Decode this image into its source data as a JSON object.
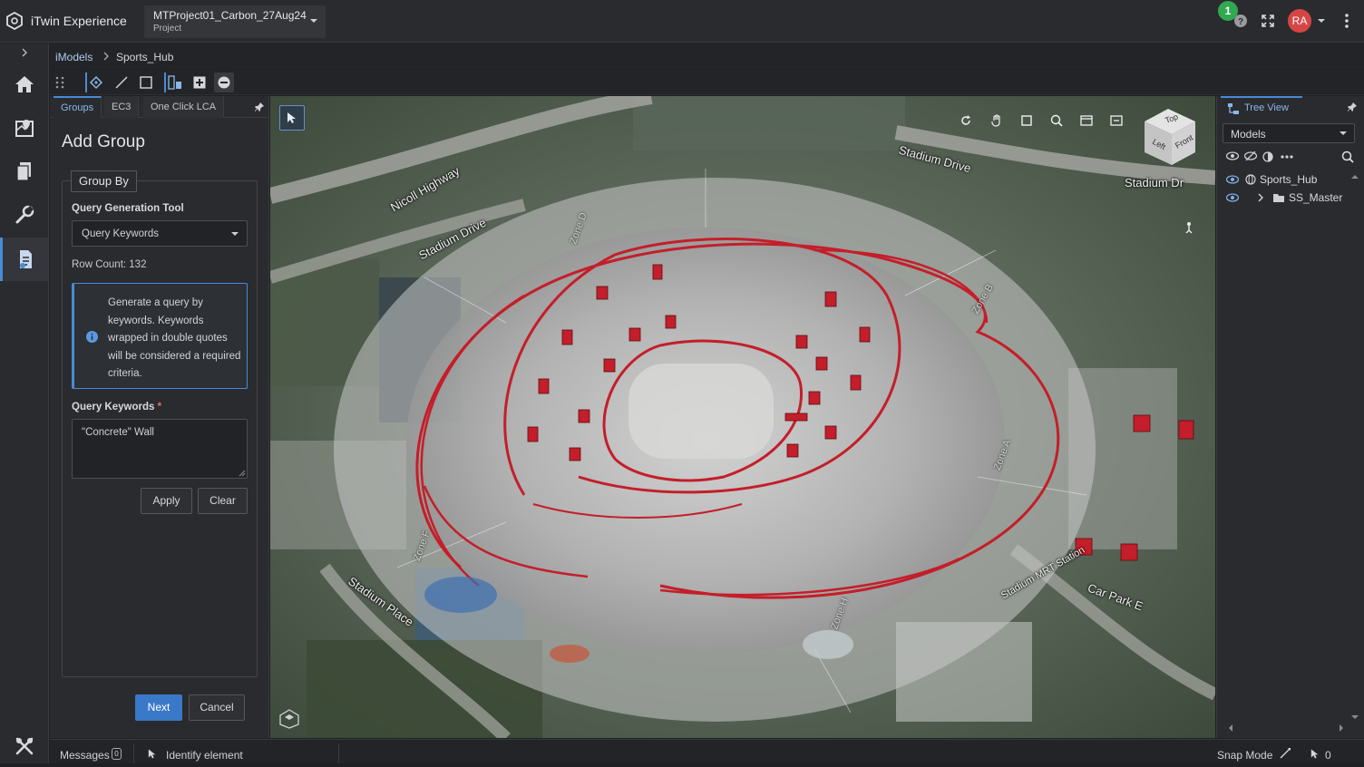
{
  "header": {
    "app_title": "iTwin Experience",
    "project_name": "MTProject01_Carbon_27Aug24",
    "project_type": "Project",
    "notification_count": "1",
    "user_initials": "RA"
  },
  "left_nav": {
    "items": [
      {
        "icon": "expand-chevron-icon"
      },
      {
        "icon": "home-icon"
      },
      {
        "icon": "map-pin-icon"
      },
      {
        "icon": "document-icon"
      },
      {
        "icon": "wrench-icon"
      },
      {
        "icon": "carbon-calculation-icon",
        "active": true
      },
      {
        "icon": "tools-icon"
      }
    ]
  },
  "breadcrumb": {
    "root": "iModels",
    "current": "Sports_Hub"
  },
  "left_panel": {
    "tabs": [
      "Groups",
      "EC3",
      "One Click LCA"
    ],
    "active_tab": "Groups",
    "title": "Add Group",
    "legend": "Group By",
    "query_tool_label": "Query Generation Tool",
    "query_tool_value": "Query Keywords",
    "row_count": "Row Count: 132",
    "info_text": "Generate a query by keywords. Keywords wrapped in double quotes will be considered a required criteria.",
    "query_keywords_label": "Query Keywords",
    "required_mark": "*",
    "query_keywords_value": "\"Concrete\" Wall",
    "apply_label": "Apply",
    "clear_label": "Clear",
    "next_label": "Next",
    "cancel_label": "Cancel"
  },
  "viewport": {
    "map_labels": [
      "Stadium Drive",
      "Nicoll Highway",
      "Stadium Drive",
      "Stadium Dr",
      "Stadium Place",
      "Car Park E",
      "Stadium MRT Station",
      "Zone B",
      "Zone D",
      "Zone A",
      "Zone F",
      "Zone H"
    ],
    "view_cube": {
      "top": "Top",
      "left": "Left",
      "front": "Front"
    },
    "highlight_color": "#c41e2a"
  },
  "right_panel": {
    "tab_label": "Tree View",
    "models_select": "Models",
    "tree": [
      {
        "label": "Sports_Hub",
        "level": 0
      },
      {
        "label": "SS_Master",
        "level": 1
      }
    ]
  },
  "status_bar": {
    "messages_label": "Messages",
    "messages_count": "0",
    "identify_label": "Identify element",
    "snap_mode_label": "Snap Mode",
    "selection_count": "0"
  },
  "colors": {
    "accent": "#4a8bd6",
    "primary_button": "#3a79c8",
    "notification": "#32a852",
    "avatar": "#d64545"
  }
}
